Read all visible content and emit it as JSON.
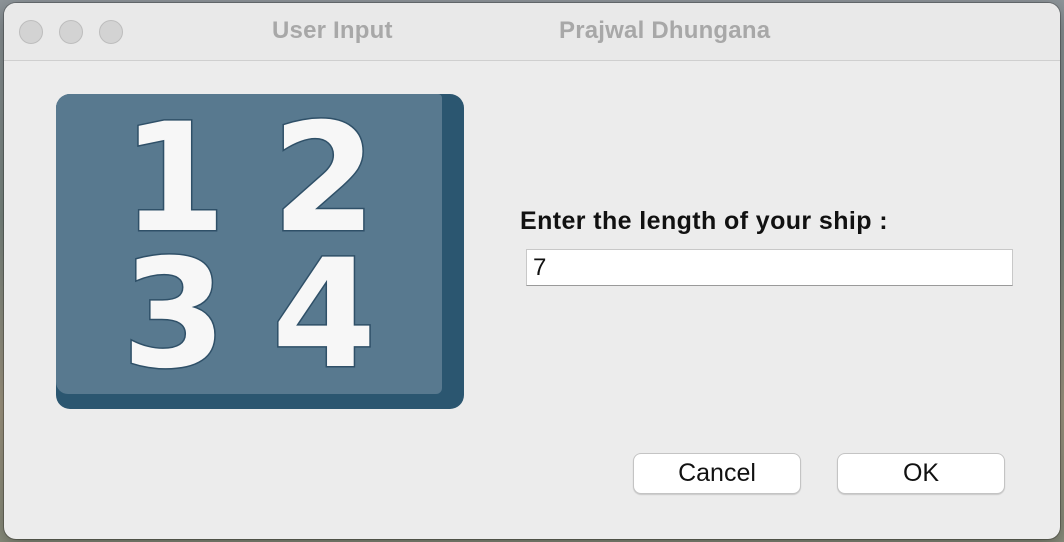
{
  "window": {
    "title": "User Input",
    "subtitle": "Prajwal Dhungana"
  },
  "icon": {
    "name": "numbers-icon",
    "digits": [
      "1",
      "2",
      "3",
      "4"
    ]
  },
  "dialog": {
    "prompt": "Enter the length of your ship :",
    "input_value": "7"
  },
  "buttons": {
    "cancel_label": "Cancel",
    "ok_label": "OK"
  },
  "colors": {
    "icon_face": "#58798f",
    "icon_edge": "#2b5670",
    "window_bg": "#ececec"
  }
}
